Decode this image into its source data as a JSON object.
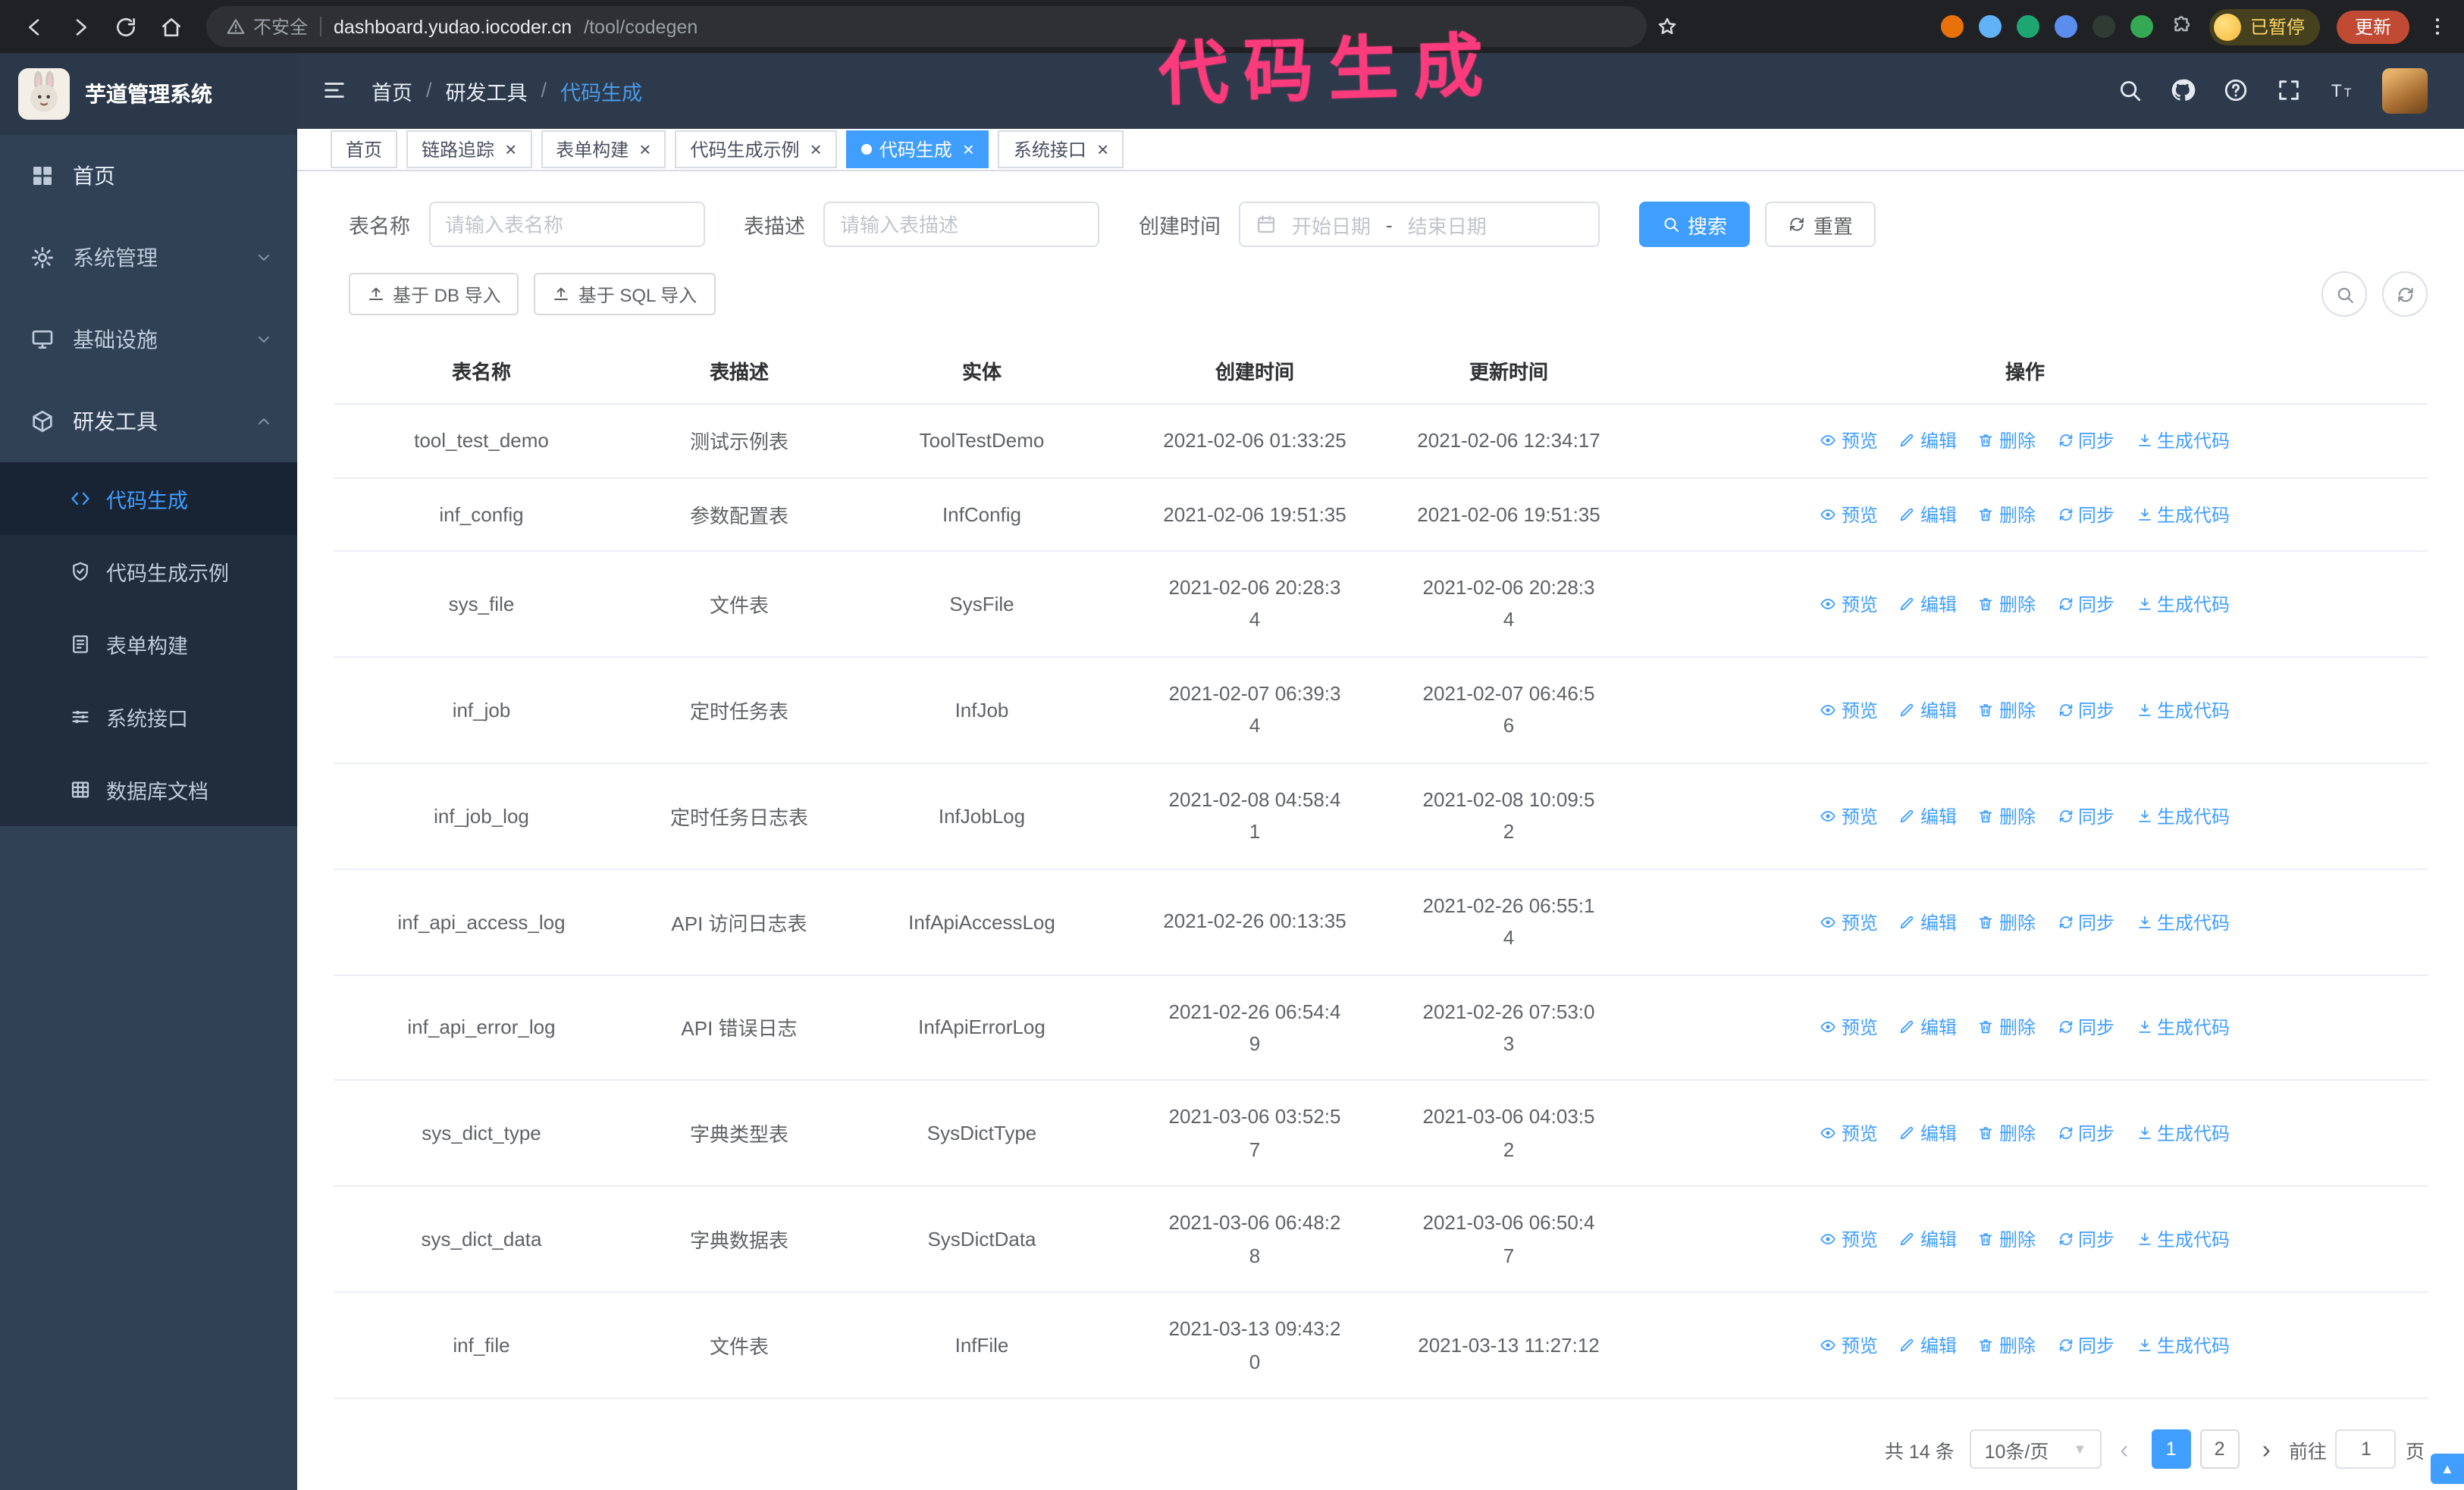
{
  "colors": {
    "primary": "#409eff",
    "annotation": "#fb3b7c"
  },
  "browser": {
    "nav_icons": [
      "back-icon",
      "forward-icon",
      "reload-icon",
      "home-icon"
    ],
    "security_text": "不安全",
    "url_host": "dashboard.yudao.iocoder.cn",
    "url_path": "/tool/codegen",
    "bookmark_icon": "star-icon",
    "extensions": [
      {
        "color": "#e8710a"
      },
      {
        "color": "#62b2f8"
      },
      {
        "color": "#1ea672"
      },
      {
        "color": "#5b8def"
      },
      {
        "color": "#2f3b33"
      },
      {
        "color": "#34a853"
      }
    ],
    "puzzle_icon": "puzzle-icon",
    "profile_badge": "已暂停",
    "update_button": "更新",
    "menu_icon": "kebab-icon"
  },
  "annotation": {
    "text": "代码生成"
  },
  "app_header": {
    "logo_title": "芋道管理系统",
    "collapse_icon": "hamburger-icon",
    "breadcrumb": [
      {
        "label": "首页"
      },
      {
        "label": "研发工具"
      },
      {
        "label": "代码生成",
        "current": true
      }
    ],
    "right_icons": [
      "search-icon",
      "github-icon",
      "question-icon",
      "fullscreen-icon",
      "fontsize-icon"
    ],
    "avatar_caret_icon": "caret-down-icon"
  },
  "tabs": [
    {
      "label": "首页",
      "name": "home",
      "closable": false,
      "active": false
    },
    {
      "label": "链路追踪",
      "name": "tracer",
      "closable": true,
      "active": false
    },
    {
      "label": "表单构建",
      "name": "form-build",
      "closable": true,
      "active": false
    },
    {
      "label": "代码生成示例",
      "name": "codegen-example",
      "closable": true,
      "active": false
    },
    {
      "label": "代码生成",
      "name": "codegen",
      "closable": true,
      "active": true
    },
    {
      "label": "系统接口",
      "name": "system-api",
      "closable": true,
      "active": false
    }
  ],
  "sidebar": {
    "items": [
      {
        "label": "首页",
        "icon": "dashboard-icon",
        "name": "home"
      },
      {
        "label": "系统管理",
        "icon": "gear-icon",
        "chevron": "chevron-down-icon",
        "name": "system"
      },
      {
        "label": "基础设施",
        "icon": "infra-icon",
        "chevron": "chevron-down-icon",
        "name": "infra"
      },
      {
        "label": "研发工具",
        "icon": "tools-icon",
        "chevron": "chevron-up-icon",
        "name": "dev-tools",
        "expanded": true,
        "children": [
          {
            "label": "代码生成",
            "icon": "code-icon",
            "active": true,
            "name": "codegen"
          },
          {
            "label": "代码生成示例",
            "icon": "example-icon",
            "name": "codegen-example"
          },
          {
            "label": "表单构建",
            "icon": "form-icon",
            "name": "form-build"
          },
          {
            "label": "系统接口",
            "icon": "api-icon",
            "name": "system-api"
          },
          {
            "label": "数据库文档",
            "icon": "dbdoc-icon",
            "name": "db-doc"
          }
        ]
      }
    ]
  },
  "filters": {
    "table_name_label": "表名称",
    "table_name_placeholder": "请输入表名称",
    "table_desc_label": "表描述",
    "table_desc_placeholder": "请输入表描述",
    "create_time_label": "创建时间",
    "calendar_icon": "calendar-icon",
    "date_start_placeholder": "开始日期",
    "date_separator": "-",
    "date_end_placeholder": "结束日期",
    "search_icon": "search-icon",
    "search_button": "搜索",
    "reset_icon": "refresh-icon",
    "reset_button": "重置"
  },
  "toolbar": {
    "import_icon": "upload-icon",
    "import_db": "基于 DB 导入",
    "import_sql": "基于 SQL 导入",
    "search_icon": "search-icon",
    "refresh_icon": "refresh-icon"
  },
  "table": {
    "columns": [
      "表名称",
      "表描述",
      "实体",
      "创建时间",
      "更新时间",
      "操作"
    ],
    "row_actions": [
      {
        "label": "预览",
        "icon": "eye-icon",
        "name": "preview-link"
      },
      {
        "label": "编辑",
        "icon": "edit-icon",
        "name": "edit-link"
      },
      {
        "label": "删除",
        "icon": "delete-icon",
        "name": "delete-link"
      },
      {
        "label": "同步",
        "icon": "sync-icon",
        "name": "sync-link"
      },
      {
        "label": "生成代码",
        "icon": "gen-icon",
        "name": "generate-code-link"
      }
    ],
    "rows": [
      {
        "name": "tool_test_demo",
        "desc": "测试示例表",
        "entity": "ToolTestDemo",
        "create_time": "2021-02-06 01:33:25",
        "update_time": "2021-02-06 12:34:17"
      },
      {
        "name": "inf_config",
        "desc": "参数配置表",
        "entity": "InfConfig",
        "create_time": "2021-02-06 19:51:35",
        "update_time": "2021-02-06 19:51:35"
      },
      {
        "name": "sys_file",
        "desc": "文件表",
        "entity": "SysFile",
        "create_time": "2021-02-06 20:28:3\n4",
        "update_time": "2021-02-06 20:28:3\n4"
      },
      {
        "name": "inf_job",
        "desc": "定时任务表",
        "entity": "InfJob",
        "create_time": "2021-02-07 06:39:3\n4",
        "update_time": "2021-02-07 06:46:5\n6"
      },
      {
        "name": "inf_job_log",
        "desc": "定时任务日志表",
        "entity": "InfJobLog",
        "create_time": "2021-02-08 04:58:4\n1",
        "update_time": "2021-02-08 10:09:5\n2"
      },
      {
        "name": "inf_api_access_log",
        "desc": "API 访问日志表",
        "entity": "InfApiAccessLog",
        "create_time": "2021-02-26 00:13:35",
        "update_time": "2021-02-26 06:55:1\n4"
      },
      {
        "name": "inf_api_error_log",
        "desc": "API 错误日志",
        "entity": "InfApiErrorLog",
        "create_time": "2021-02-26 06:54:4\n9",
        "update_time": "2021-02-26 07:53:0\n3"
      },
      {
        "name": "sys_dict_type",
        "desc": "字典类型表",
        "entity": "SysDictType",
        "create_time": "2021-03-06 03:52:5\n7",
        "update_time": "2021-03-06 04:03:5\n2"
      },
      {
        "name": "sys_dict_data",
        "desc": "字典数据表",
        "entity": "SysDictData",
        "create_time": "2021-03-06 06:48:2\n8",
        "update_time": "2021-03-06 06:50:4\n7"
      },
      {
        "name": "inf_file",
        "desc": "文件表",
        "entity": "InfFile",
        "create_time": "2021-03-13 09:43:2\n0",
        "update_time": "2021-03-13 11:27:12"
      }
    ]
  },
  "pagination": {
    "total": "共 14 条",
    "page_size": "10条/页",
    "pages": [
      "1",
      "2"
    ],
    "active_page": "1",
    "goto_label": "前往",
    "goto_value": "1",
    "goto_suffix": "页"
  }
}
